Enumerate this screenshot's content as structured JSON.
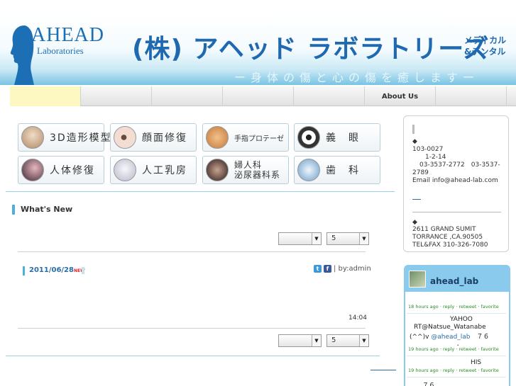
{
  "header": {
    "logo_main": "AHEAD",
    "logo_sub": "Laboratories",
    "company_name": "(株) アヘッド ラボラトリーズ",
    "tagline_1": "メディカル",
    "tagline_2": "&デンタル",
    "slogan": "ー身体の傷と心の傷を癒しますー"
  },
  "nav": {
    "items": [
      "",
      "",
      "",
      "",
      "",
      "About Us",
      ""
    ]
  },
  "categories": [
    {
      "label": "3D造形模型",
      "icon": "skull-icon",
      "color": "#c9a88a"
    },
    {
      "label": "顔面修復",
      "icon": "eye-icon",
      "color": "#e7c9bf"
    },
    {
      "label": "手指プロテーゼ",
      "icon": "hand-icon",
      "color": "#e9a86e"
    },
    {
      "label": "義　眼",
      "icon": "artificial-eye-icon",
      "color": "#555555"
    },
    {
      "label": "人体修復",
      "icon": "body-icon",
      "color": "#5a3a48"
    },
    {
      "label": "人工乳房",
      "icon": "breast-icon",
      "color": "#d6d6e4"
    },
    {
      "label": "婦人科\n泌尿器科系",
      "icon": "gynecology-icon",
      "color": "#3a2a2a"
    },
    {
      "label": "歯　科",
      "icon": "tooth-icon",
      "color": "#8fb6d8"
    }
  ],
  "news": {
    "title": "What's New",
    "select_top": {
      "category_value": "",
      "count_value": "5"
    },
    "select_bottom": {
      "category_value": "",
      "count_value": "5"
    },
    "post": {
      "date": "2011/06/28",
      "new_badge": "NEW",
      "share_by": "| by:admin",
      "time": "14:04"
    }
  },
  "address": {
    "jp_marker": "◆",
    "jp_zip": "103-0027",
    "jp_addr": "1-2-14",
    "jp_tel": "03-3537-2772　03-3537-",
    "jp_tel2": "2789",
    "jp_email": "Email info@ahead-lab.com",
    "us_marker": "◆",
    "us_addr1": "2611 GRAND SUMIT",
    "us_addr2": "TORRANCE ,CA.90505",
    "us_tel": "TEL&FAX 310-326-7080"
  },
  "twitter": {
    "username": "ahead_lab",
    "meta_1": "18 hours ago · reply · retweet · favorite",
    "tweet_2_line1": "YAHOO",
    "tweet_2_line2": "RT@Natsue_Watanabe",
    "tweet_2_line3_pre": "(^^)v ",
    "tweet_2_handle": "@ahead_lab",
    "tweet_2_line3_post": "　７６",
    "tweet_2_line4": "．",
    "meta_2": "19 hours ago · reply · retweet · favorite",
    "tweet_3_line1": "HIS",
    "meta_3": "19 hours ago · reply · retweet · favorite",
    "tweet_4_line1": "７６"
  }
}
